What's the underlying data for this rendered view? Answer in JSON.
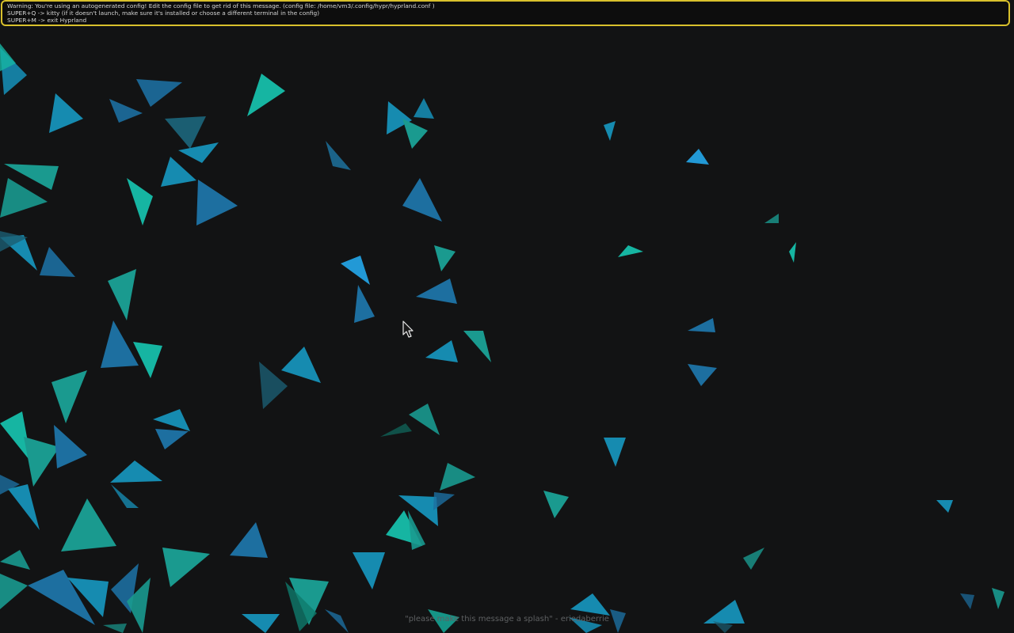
{
  "banner": {
    "lines": [
      "Warning: You're using an autogenerated config! Edit the config file to get rid of this message. (config file: /home/vm3/.config/hypr/hyprland.conf )",
      "SUPER+Q -> kitty (if it doesn't launch, make sure it's installed or choose a different terminal in the config)",
      "SUPER+M -> exit Hyprland"
    ],
    "border_color": "#d8c02c"
  },
  "splash": {
    "text": "\"please make this message a splash\" - eriedaberrie"
  },
  "wallpaper": {
    "background": "#121314",
    "palette": [
      "#16b5a2",
      "#1a9a8f",
      "#168bb0",
      "#1d6fa0",
      "#1b5e72",
      "#2299d6",
      "#0f7b6c"
    ]
  },
  "cursor": {
    "icon": "arrow-pointer-icon"
  }
}
